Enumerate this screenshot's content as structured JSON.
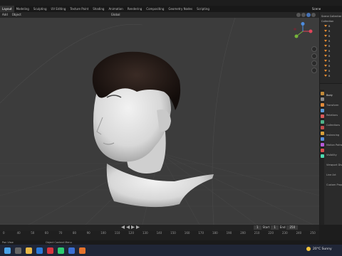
{
  "menu": {
    "workspaces": [
      "Layout",
      "Modeling",
      "Sculpting",
      "UV Editing",
      "Texture Paint",
      "Shading",
      "Animation",
      "Rendering",
      "Compositing",
      "Geometry Nodes",
      "Scripting"
    ],
    "active": "Layout",
    "scene": "Scene"
  },
  "header": {
    "add": "Add",
    "object": "Object",
    "orientation": "Global"
  },
  "outliner": {
    "rows": [
      "Scene Collection",
      "Collection",
      "B",
      "B",
      "B",
      "B",
      "B",
      "B",
      "B",
      "B",
      "B",
      "B",
      "B"
    ]
  },
  "properties": {
    "object_name": "Body",
    "rows": [
      "Transform",
      "Relations",
      "Collections",
      "Instancing",
      "Motion Paths",
      "Visibility",
      "Viewport Display",
      "Line Art",
      "Custom Properties"
    ]
  },
  "timeline": {
    "ticks": [
      "0",
      "40",
      "50",
      "60",
      "70",
      "80",
      "90",
      "100",
      "110",
      "120",
      "130",
      "140",
      "150",
      "160",
      "170",
      "180",
      "190",
      "200",
      "210",
      "220",
      "230",
      "240",
      "250"
    ],
    "current_frame": "1",
    "start_label": "Start",
    "start": "1",
    "end_label": "End",
    "end": "250"
  },
  "status": {
    "left": "Pan View",
    "middle": "Object Context Menu"
  },
  "taskbar": {
    "weather": "20°C Sunny"
  }
}
